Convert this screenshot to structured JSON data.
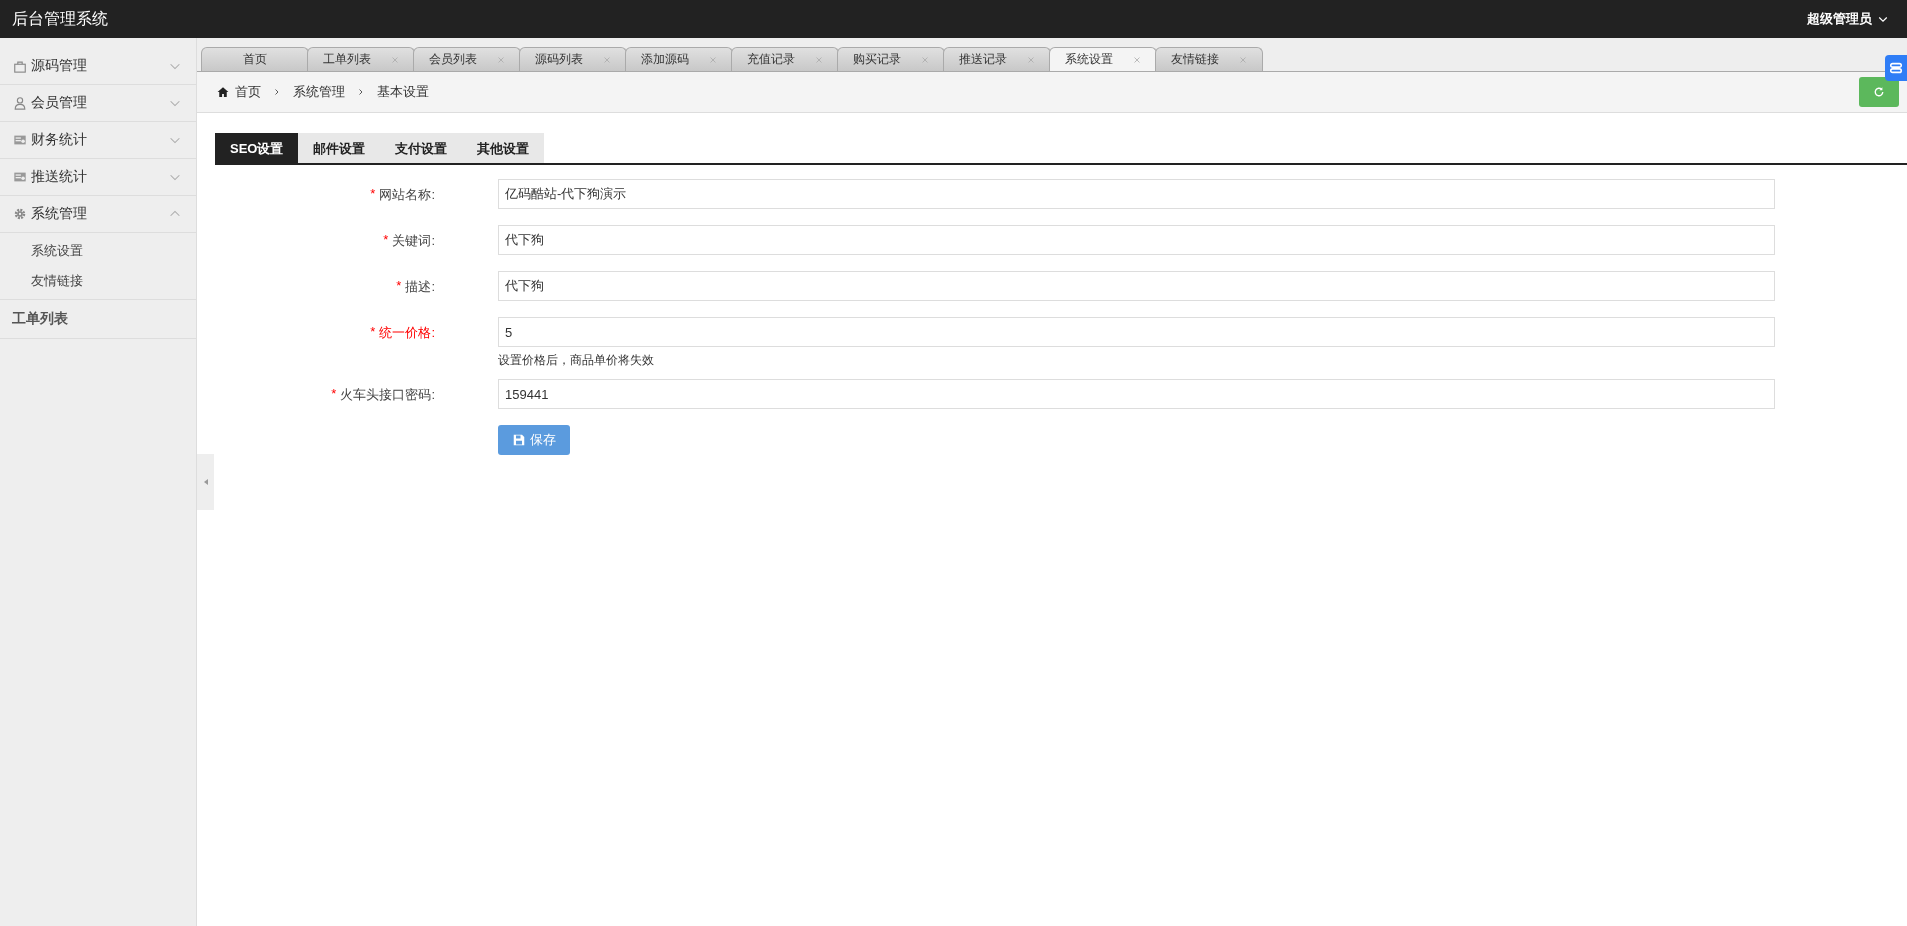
{
  "header": {
    "title": "后台管理系统",
    "user": "超级管理员"
  },
  "sidebar": {
    "items": [
      {
        "kind": "menu",
        "label": "源码管理",
        "expanded": false
      },
      {
        "kind": "menu",
        "label": "会员管理",
        "expanded": false
      },
      {
        "kind": "menu",
        "label": "财务统计",
        "expanded": false
      },
      {
        "kind": "menu",
        "label": "推送统计",
        "expanded": false
      },
      {
        "kind": "menu",
        "label": "系统管理",
        "expanded": true,
        "children": [
          {
            "label": "系统设置"
          },
          {
            "label": "友情链接"
          }
        ]
      },
      {
        "kind": "plain",
        "label": "工单列表"
      }
    ]
  },
  "tabs": [
    {
      "label": "首页",
      "closable": false,
      "selected": false
    },
    {
      "label": "工单列表",
      "closable": true,
      "selected": false
    },
    {
      "label": "会员列表",
      "closable": true,
      "selected": false
    },
    {
      "label": "源码列表",
      "closable": true,
      "selected": false
    },
    {
      "label": "添加源码",
      "closable": true,
      "selected": false
    },
    {
      "label": "充值记录",
      "closable": true,
      "selected": false
    },
    {
      "label": "购买记录",
      "closable": true,
      "selected": false
    },
    {
      "label": "推送记录",
      "closable": true,
      "selected": false
    },
    {
      "label": "系统设置",
      "closable": true,
      "selected": true
    },
    {
      "label": "友情链接",
      "closable": true,
      "selected": false
    }
  ],
  "breadcrumb": [
    "首页",
    "系统管理",
    "基本设置"
  ],
  "settings_tabs": [
    {
      "label": "SEO设置",
      "selected": true
    },
    {
      "label": "邮件设置",
      "selected": false
    },
    {
      "label": "支付设置",
      "selected": false
    },
    {
      "label": "其他设置",
      "selected": false
    }
  ],
  "form": {
    "fields": [
      {
        "marker": "*",
        "label": "网站名称:",
        "value": "亿码酷站-代下狗演示",
        "highlighted": false
      },
      {
        "marker": "*",
        "label": "关键词:",
        "value": "代下狗",
        "highlighted": false
      },
      {
        "marker": "*",
        "label": "描述:",
        "value": "代下狗",
        "highlighted": false
      },
      {
        "marker": "*",
        "label": "统一价格:",
        "value": "5",
        "highlighted": true,
        "hint": "设置价格后，商品单价将失效"
      },
      {
        "marker": "*",
        "label": "火车头接口密码:",
        "value": "159441",
        "highlighted": false
      }
    ],
    "submit": "保存"
  }
}
